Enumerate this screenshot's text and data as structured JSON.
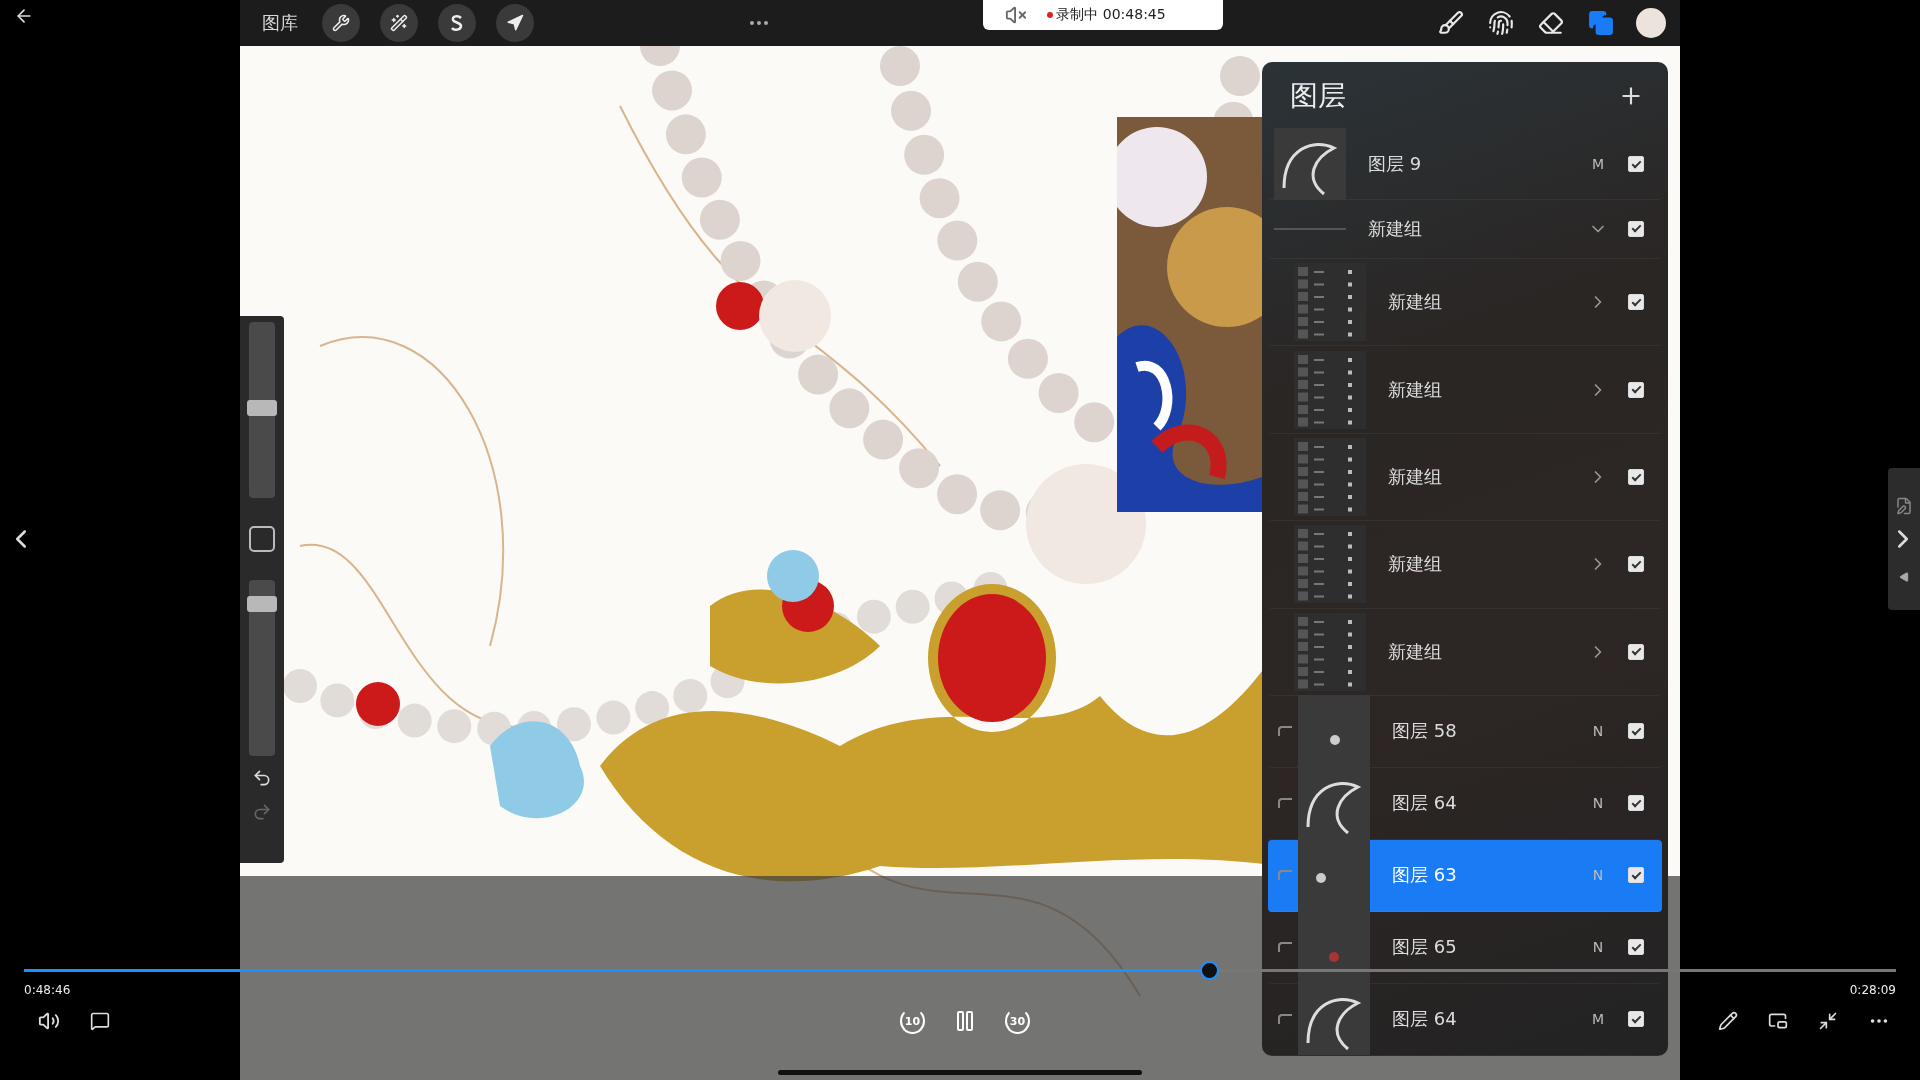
{
  "toolbar": {
    "gallery": "图库",
    "recording": "录制中 00:48:45",
    "tools": [
      {
        "kind": "brush",
        "selected": false
      },
      {
        "kind": "smudge",
        "selected": false
      },
      {
        "kind": "eraser",
        "selected": false
      },
      {
        "kind": "layers",
        "selected": true
      }
    ]
  },
  "sidebar": {
    "brush_size": {
      "level": 0.51
    },
    "opacity": {
      "level": 0.9
    }
  },
  "layers_panel": {
    "title": "图层",
    "layers": [
      {
        "kind": "layer",
        "name": "图层 9",
        "blend": "M",
        "visible": true,
        "clipped": false,
        "selected": false
      },
      {
        "kind": "group",
        "name": "新建组",
        "expanded": true,
        "visible": true,
        "selected": false,
        "children": [
          {
            "kind": "group",
            "name": "新建组",
            "expanded": false,
            "visible": true,
            "selected": false
          },
          {
            "kind": "group",
            "name": "新建组",
            "expanded": false,
            "visible": true,
            "selected": false
          },
          {
            "kind": "group",
            "name": "新建组",
            "expanded": false,
            "visible": true,
            "selected": false
          },
          {
            "kind": "group",
            "name": "新建组",
            "expanded": false,
            "visible": true,
            "selected": false
          },
          {
            "kind": "group",
            "name": "新建组",
            "expanded": false,
            "visible": true,
            "selected": false
          },
          {
            "kind": "layer",
            "name": "图层 58",
            "blend": "N",
            "visible": true,
            "clipped": true,
            "selected": false
          },
          {
            "kind": "layer",
            "name": "图层 64",
            "blend": "N",
            "visible": true,
            "clipped": true,
            "selected": false
          },
          {
            "kind": "layer",
            "name": "图层 63",
            "blend": "N",
            "visible": true,
            "clipped": true,
            "selected": true
          },
          {
            "kind": "layer",
            "name": "图层 65",
            "blend": "N",
            "visible": true,
            "clipped": true,
            "selected": false
          },
          {
            "kind": "layer",
            "name": "图层 64",
            "blend": "M",
            "visible": true,
            "clipped": true,
            "selected": false
          }
        ]
      }
    ]
  },
  "player": {
    "elapsed": "0:48:46",
    "remaining": "0:28:09",
    "level": 0.633,
    "skip_back": "10",
    "skip_forward": "30"
  }
}
